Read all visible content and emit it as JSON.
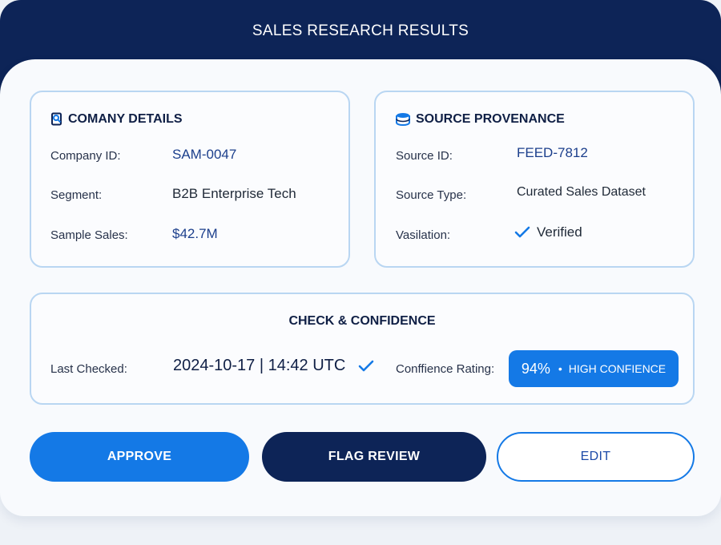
{
  "header": {
    "title": "SALES RESEARCH RESULTS"
  },
  "company": {
    "title": "COMANY DETAILS",
    "icon": "search-document-icon",
    "rows": [
      {
        "label": "Company ID:",
        "value": "SAM-0047"
      },
      {
        "label": "Segment:",
        "value": "B2B Enterprise Tech"
      },
      {
        "label": "Sample Sales:",
        "value": "$42.7M"
      }
    ]
  },
  "source": {
    "title": "SOURCE PROVENANCE",
    "icon": "database-icon",
    "rows": [
      {
        "label": "Source ID:",
        "value": "FEED-7812"
      },
      {
        "label": "Source Type:",
        "value": "Curated Sales Dataset"
      },
      {
        "label": "Vasilation:",
        "value": "Verified"
      }
    ]
  },
  "check": {
    "title": "CHECK & CONFIDENCE",
    "last_checked_label": "Last Checked:",
    "last_checked_value": "2024-10-17 | 14:42 UTC",
    "confidence_label": "Conffience Rating:",
    "confidence_pct": "94%",
    "confidence_separator": "•",
    "confidence_level": "HIGH CONFIENCE"
  },
  "actions": {
    "approve": "APPROVE",
    "flag_review": "FLAG REVIEW",
    "edit": "EDIT"
  },
  "colors": {
    "navy": "#0d2457",
    "accent_blue": "#1479e6",
    "panel_border": "#b9d6f2",
    "value_blue": "#1c3f8c"
  }
}
